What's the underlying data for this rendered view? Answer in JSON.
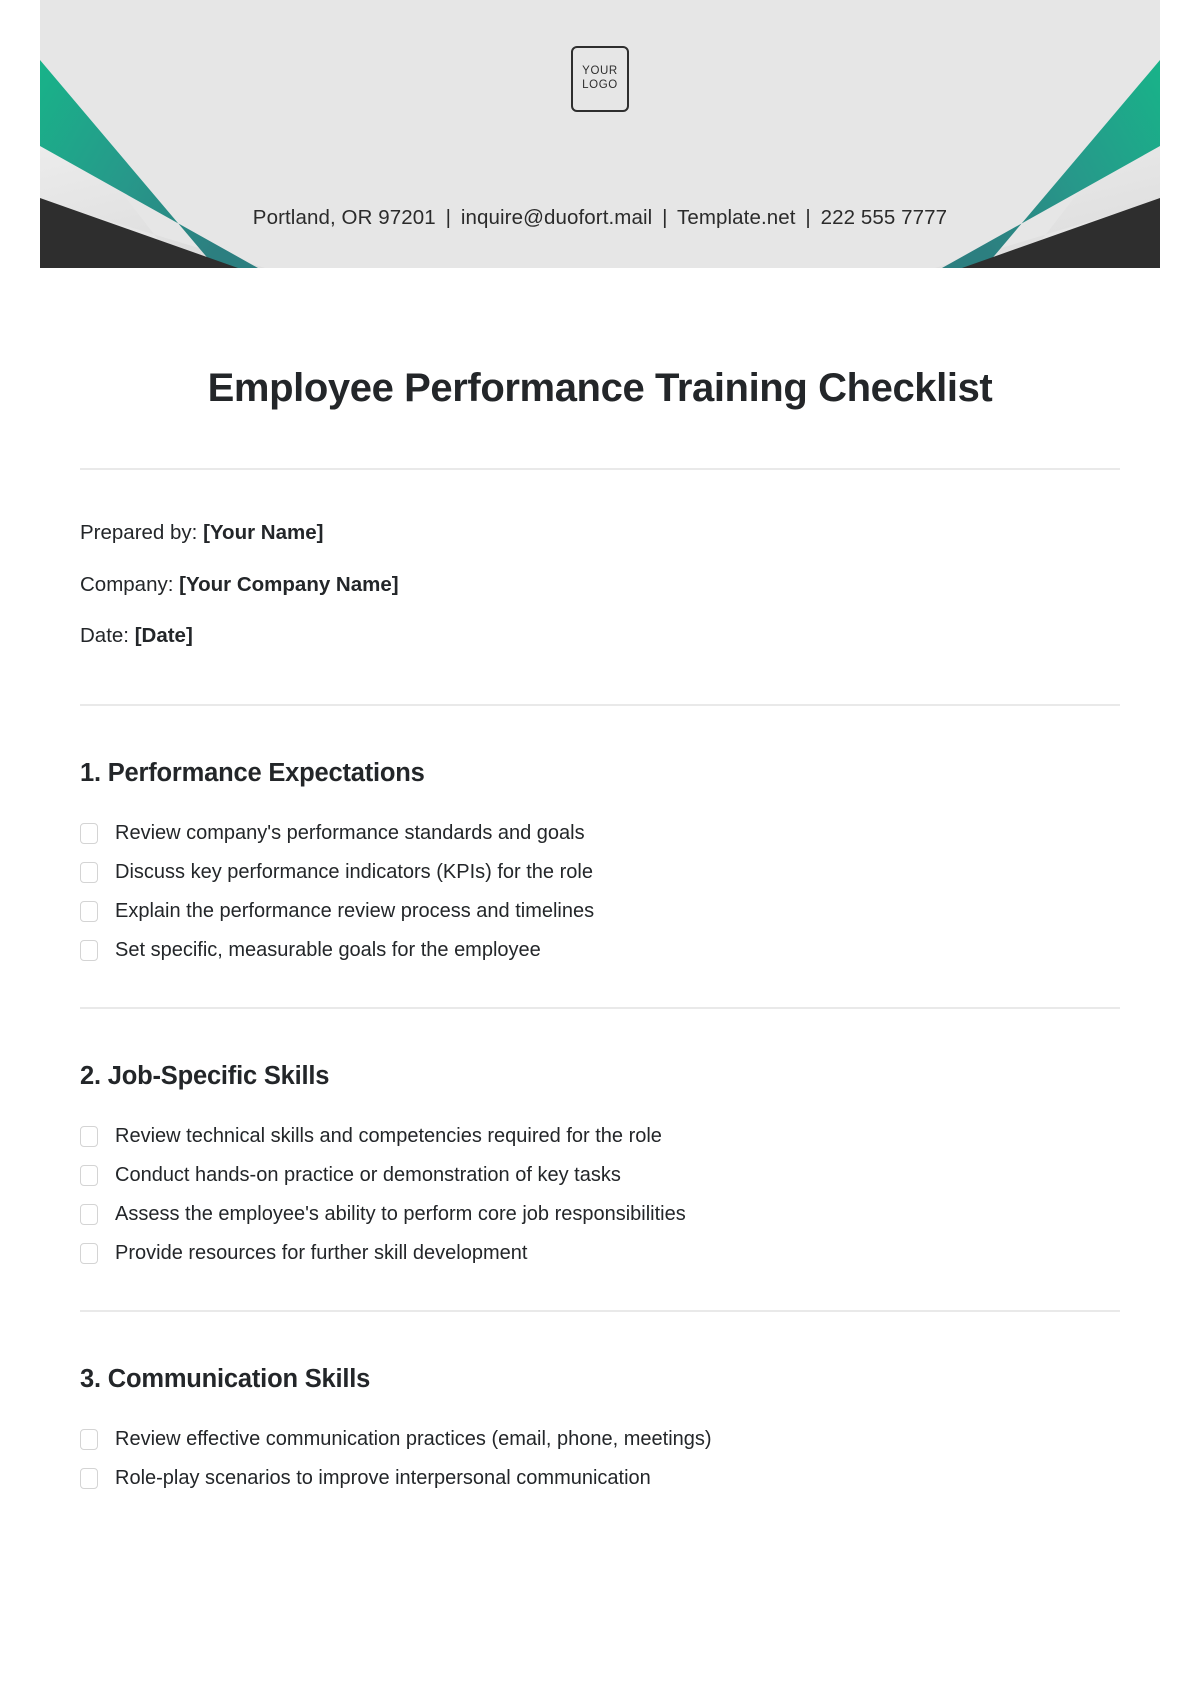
{
  "header": {
    "logo": {
      "line1": "YOUR",
      "line2": "LOGO"
    },
    "contact": {
      "address": "Portland, OR 97201",
      "email": "inquire@duofort.mail",
      "website": "Template.net",
      "phone": "222 555 7777",
      "separator": "|"
    },
    "colors": {
      "band_background": "#e6e6e6",
      "accent_green": "#1fb086",
      "accent_green_dark": "#2a8b80",
      "accent_dark": "#2e2e2e"
    }
  },
  "document": {
    "title": "Employee Performance Training Checklist",
    "meta": [
      {
        "label": "Prepared by:",
        "value": "[Your Name]"
      },
      {
        "label": "Company:",
        "value": "[Your Company Name]"
      },
      {
        "label": "Date:",
        "value": "[Date]"
      }
    ],
    "sections": [
      {
        "title": "1. Performance Expectations",
        "items": [
          "Review company's performance standards and goals",
          "Discuss key performance indicators (KPIs) for the role",
          "Explain the performance review process and timelines",
          "Set specific, measurable goals for the employee"
        ]
      },
      {
        "title": "2. Job-Specific Skills",
        "items": [
          "Review technical skills and competencies required for the role",
          "Conduct hands-on practice or demonstration of key tasks",
          "Assess the employee's ability to perform core job responsibilities",
          "Provide resources for further skill development"
        ]
      },
      {
        "title": "3. Communication Skills",
        "items": [
          "Review effective communication practices (email, phone, meetings)",
          "Role-play scenarios to improve interpersonal communication"
        ]
      }
    ]
  }
}
